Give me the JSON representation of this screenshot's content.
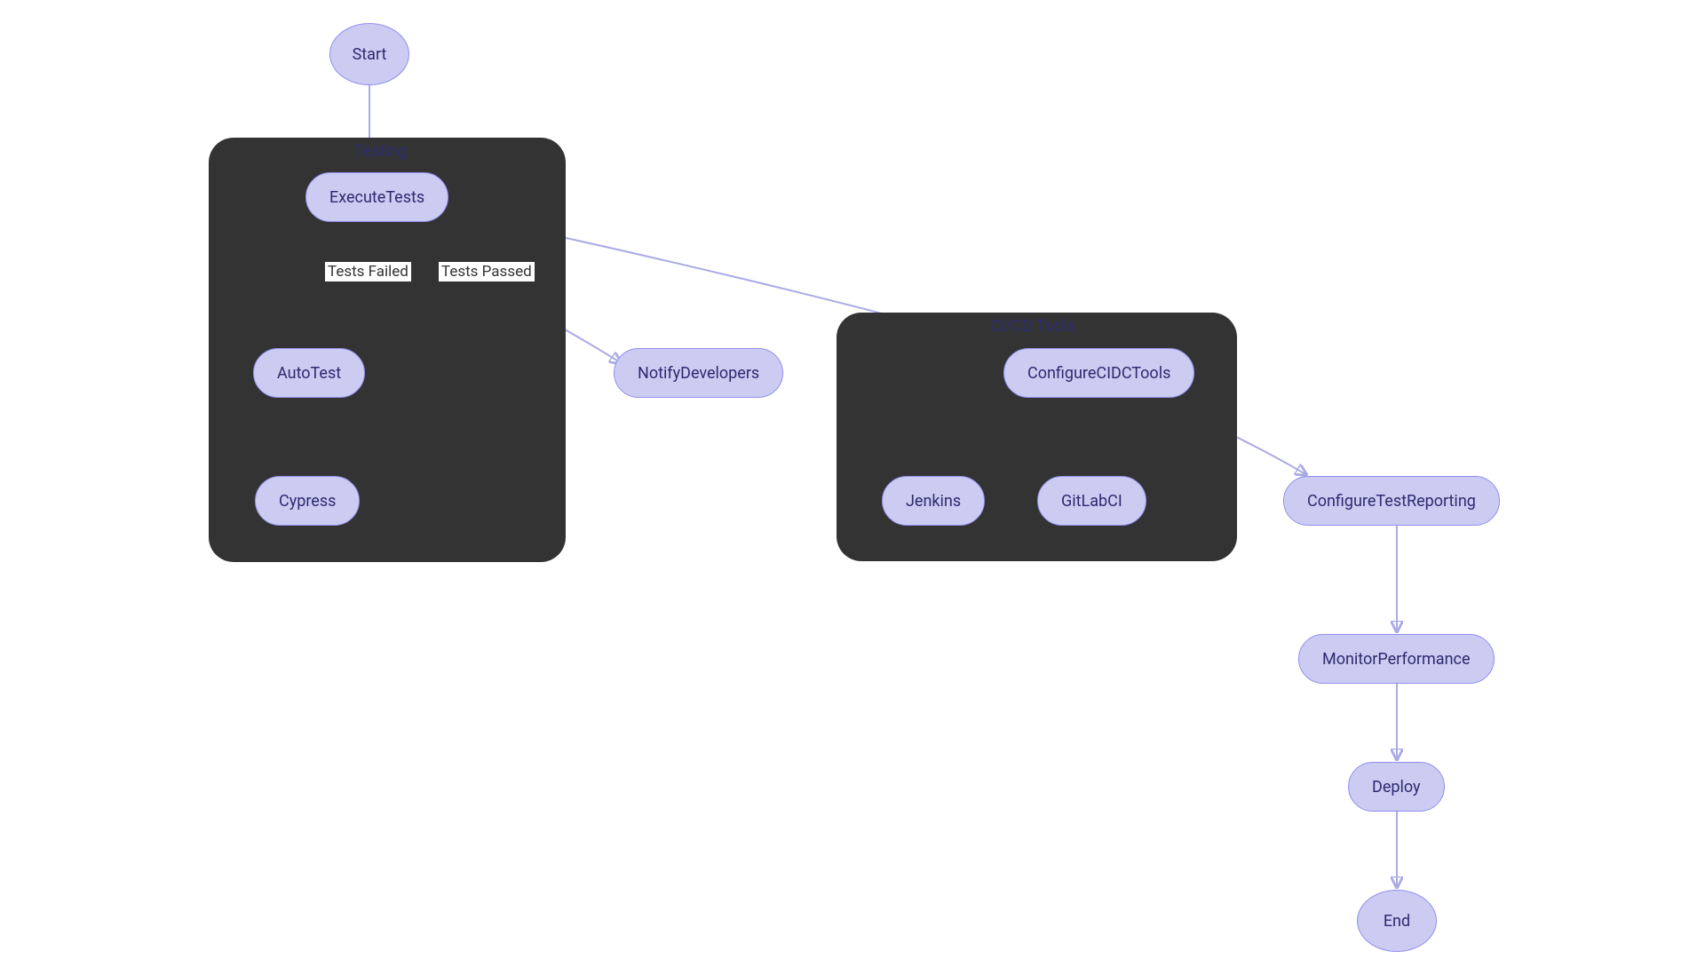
{
  "groups": {
    "testing": {
      "label": "Testing"
    },
    "cicd": {
      "label": "CI/CD Tools"
    }
  },
  "nodes": {
    "start": {
      "label": "Start"
    },
    "executeTests": {
      "label": "ExecuteTests"
    },
    "autoTest": {
      "label": "AutoTest"
    },
    "cypress": {
      "label": "Cypress"
    },
    "notifyDevelopers": {
      "label": "NotifyDevelopers"
    },
    "configureCICDTools": {
      "label": "ConfigureCIDCTools"
    },
    "jenkins": {
      "label": "Jenkins"
    },
    "gitlabCI": {
      "label": "GitLabCI"
    },
    "configureTestReporting": {
      "label": "ConfigureTestReporting"
    },
    "monitorPerformance": {
      "label": "MonitorPerformance"
    },
    "deploy": {
      "label": "Deploy"
    },
    "end": {
      "label": "End"
    }
  },
  "edgeLabels": {
    "testsFailed": "Tests Failed",
    "testsPassed": "Tests Passed"
  },
  "colors": {
    "nodeFill": "#ccccf2",
    "nodeStroke": "#9090ee",
    "nodeText": "#2b2b6f",
    "groupFill": "#333333",
    "edgeStroke": "#aaaae5"
  }
}
